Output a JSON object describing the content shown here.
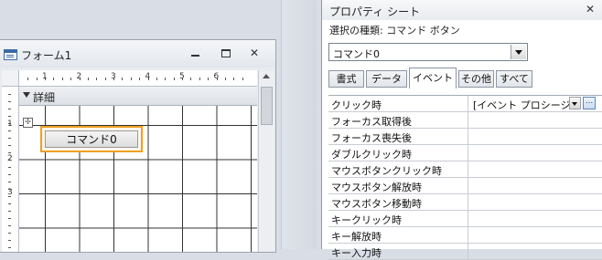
{
  "form_window": {
    "title": "フォーム1",
    "section_label": "詳細",
    "ruler_h_numbers": [
      "1",
      "2",
      "3",
      "4",
      "5",
      "6"
    ],
    "ruler_v_numbers": [
      "1",
      "2",
      "3"
    ],
    "command_button_label": "コマンド0",
    "move_handle_glyph": "✢"
  },
  "property_sheet": {
    "title": "プロパティ シート",
    "close_glyph": "✕",
    "selection_type_label": "選択の種類: コマンド ボタン",
    "selected_object": "コマンド0",
    "tabs": [
      {
        "label": "書式",
        "active": false
      },
      {
        "label": "データ",
        "active": false
      },
      {
        "label": "イベント",
        "active": true
      },
      {
        "label": "その他",
        "active": false
      },
      {
        "label": "すべて",
        "active": false
      }
    ],
    "properties": [
      {
        "name": "クリック時",
        "value": "[イベント プロシージャ"
      },
      {
        "name": "フォーカス取得後",
        "value": ""
      },
      {
        "name": "フォーカス喪失後",
        "value": ""
      },
      {
        "name": "ダブルクリック時",
        "value": ""
      },
      {
        "name": "マウスボタンクリック時",
        "value": ""
      },
      {
        "name": "マウスボタン解放時",
        "value": ""
      },
      {
        "name": "マウスボタン移動時",
        "value": ""
      },
      {
        "name": "キークリック時",
        "value": ""
      },
      {
        "name": "キー解放時",
        "value": ""
      },
      {
        "name": "キー入力時",
        "value": ""
      }
    ],
    "builder_glyph": "..."
  },
  "icons": {
    "form_icon": "form-icon",
    "minimize": "minimize-icon",
    "maximize": "maximize-icon",
    "close": "close-icon",
    "section_collapse": "collapse-arrow-icon"
  }
}
